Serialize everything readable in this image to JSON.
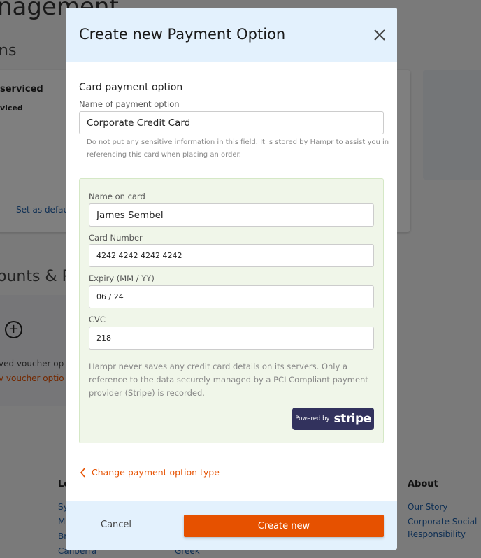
{
  "background": {
    "heading": "nagement",
    "section1": "ns",
    "card_title": "serviced",
    "card_sub": "viced",
    "set_default": "Set as defau",
    "section2": "ounts & P",
    "voucher_text": "ved voucher op",
    "voucher_link": "v voucher optio",
    "footer_col1_title": "Lo",
    "footer_col1_items": [
      "Sy",
      "M",
      "Br",
      "Canberra"
    ],
    "footer_col2_item": "Greek",
    "footer_about_title": "About",
    "footer_about_items": [
      "Our Story",
      "Corporate Social",
      "Responsibility"
    ]
  },
  "modal": {
    "title": "Create new Payment Option",
    "section_title": "Card payment option",
    "name_label": "Name of payment option",
    "name_value": "Corporate Credit Card",
    "name_help_1": "Do not put any sensitive information in this field. It is stored by Hampr to assist you in",
    "name_help_2": "referencing this card when placing an order.",
    "card": {
      "name_label": "Name on card",
      "name_value": "James Sembel",
      "number_label": "Card Number",
      "number_value": "4242 4242 4242 4242",
      "expiry_label": "Expiry (MM / YY)",
      "expiry_value": "06 / 24",
      "cvc_label": "CVC",
      "cvc_value": "218",
      "notice_1": "Hampr never saves any credit card details on its servers. Only a",
      "notice_2": "reference to the data securely managed by a PCI Compliant payment",
      "notice_3": "provider (Stripe) is recorded.",
      "powered_by": "Powered by",
      "stripe_logo": "stripe"
    },
    "change_type": "Change payment option type",
    "cancel": "Cancel",
    "create": "Create new"
  },
  "colors": {
    "accent": "#e65100",
    "header_bg": "#e3f1fd",
    "card_bg": "#f0f6e9",
    "stripe": "#32325d",
    "link_blue": "#1e5fa8"
  }
}
